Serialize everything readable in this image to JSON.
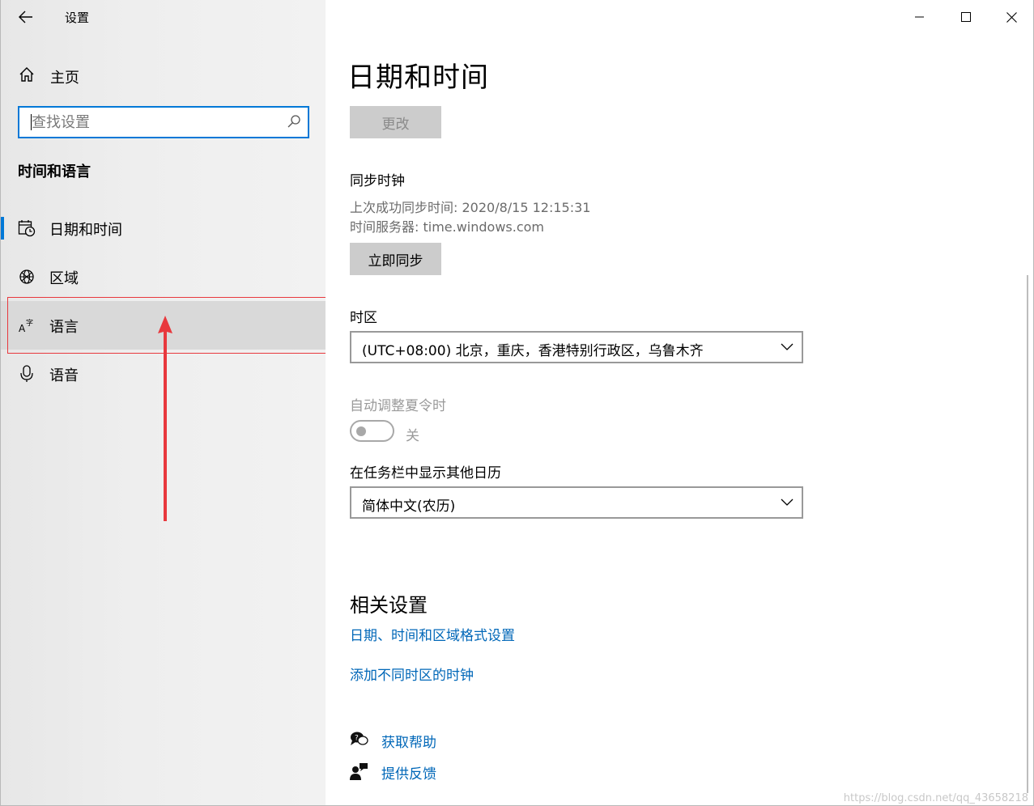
{
  "window": {
    "title": "设置"
  },
  "sidebar": {
    "home_label": "主页",
    "search_placeholder": "查找设置",
    "section_title": "时间和语言",
    "items": [
      {
        "label": "日期和时间",
        "icon": "calendar-clock-icon",
        "active": true
      },
      {
        "label": "区域",
        "icon": "globe-icon"
      },
      {
        "label": "语言",
        "icon": "language-icon"
      },
      {
        "label": "语音",
        "icon": "microphone-icon"
      }
    ]
  },
  "main": {
    "title": "日期和时间",
    "change_button": "更改",
    "sync": {
      "heading": "同步时钟",
      "last_sync": "上次成功同步时间: 2020/8/15 12:15:31",
      "server": "时间服务器: time.windows.com",
      "button": "立即同步"
    },
    "timezone": {
      "label": "时区",
      "value": "(UTC+08:00) 北京，重庆，香港特别行政区，乌鲁木齐"
    },
    "dst": {
      "label": "自动调整夏令时",
      "state": "关",
      "on": false
    },
    "calendar": {
      "label": "在任务栏中显示其他日历",
      "value": "简体中文(农历)"
    },
    "related": {
      "title": "相关设置",
      "links": [
        "日期、时间和区域格式设置",
        "添加不同时区的时钟"
      ]
    },
    "help": {
      "get_help": "获取帮助",
      "feedback": "提供反馈"
    }
  },
  "watermark": "https://blog.csdn.net/qq_43658218",
  "colors": {
    "accent": "#0078d7",
    "link": "#0067b8",
    "annotation": "#e8383d"
  }
}
